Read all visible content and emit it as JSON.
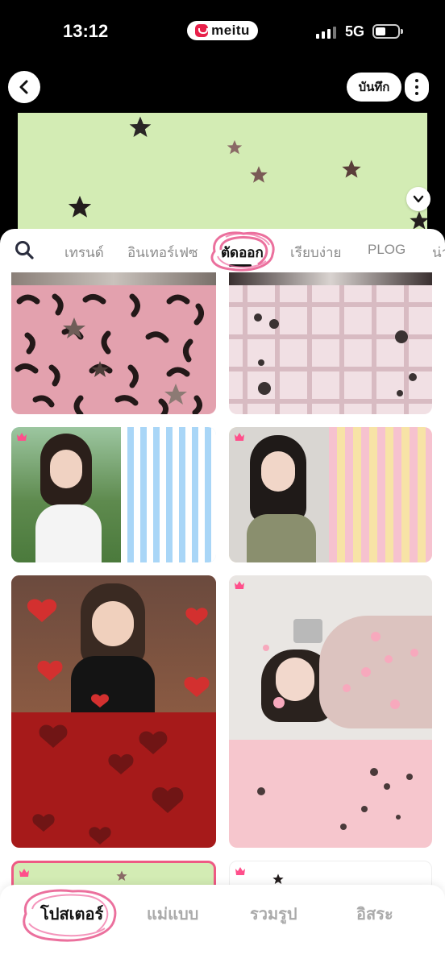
{
  "status": {
    "time": "13:12",
    "app_name": "meitu",
    "network": "5G",
    "battery_level": 0.45
  },
  "header": {
    "save_label": "บันทึก"
  },
  "categories": {
    "tabs": [
      {
        "label": "เทรนด์",
        "active": false
      },
      {
        "label": "อินเทอร์เฟซ",
        "active": false
      },
      {
        "label": "ตัดออก",
        "active": true
      },
      {
        "label": "เรียบง่าย",
        "active": false
      },
      {
        "label": "PLOG",
        "active": false
      },
      {
        "label": "น่า",
        "active": false
      }
    ]
  },
  "templates": [
    {
      "name": "pink-leopard-stars",
      "colors": [
        "#e9a7b2",
        "#2a1a1a"
      ]
    },
    {
      "name": "pink-plaid-flowers",
      "colors": [
        "#f1dfe3",
        "#caa8b0"
      ]
    },
    {
      "name": "blue-stripes-portrait",
      "colors": [
        "#a9d6f7",
        "#ffffff"
      ],
      "premium": true
    },
    {
      "name": "yellow-pink-stripes-portrait",
      "colors": [
        "#f7e3a6",
        "#f6c2cf"
      ],
      "premium": true
    },
    {
      "name": "red-hearts-portrait",
      "colors": [
        "#a61a1a",
        "#d33a3a"
      ]
    },
    {
      "name": "pink-sakura-portrait",
      "colors": [
        "#f6c6cd",
        "#ffffff"
      ],
      "premium": true
    },
    {
      "name": "green-stars",
      "colors": [
        "#d3ecb4"
      ],
      "premium": true
    },
    {
      "name": "white-stars",
      "colors": [
        "#ffffff"
      ],
      "premium": true
    }
  ],
  "bottom_nav": [
    {
      "label": "โปสเตอร์",
      "active": true
    },
    {
      "label": "แม่แบบ",
      "active": false
    },
    {
      "label": "รวมรูป",
      "active": false
    },
    {
      "label": "อิสระ",
      "active": false
    }
  ],
  "accent_color": "#e8204a"
}
